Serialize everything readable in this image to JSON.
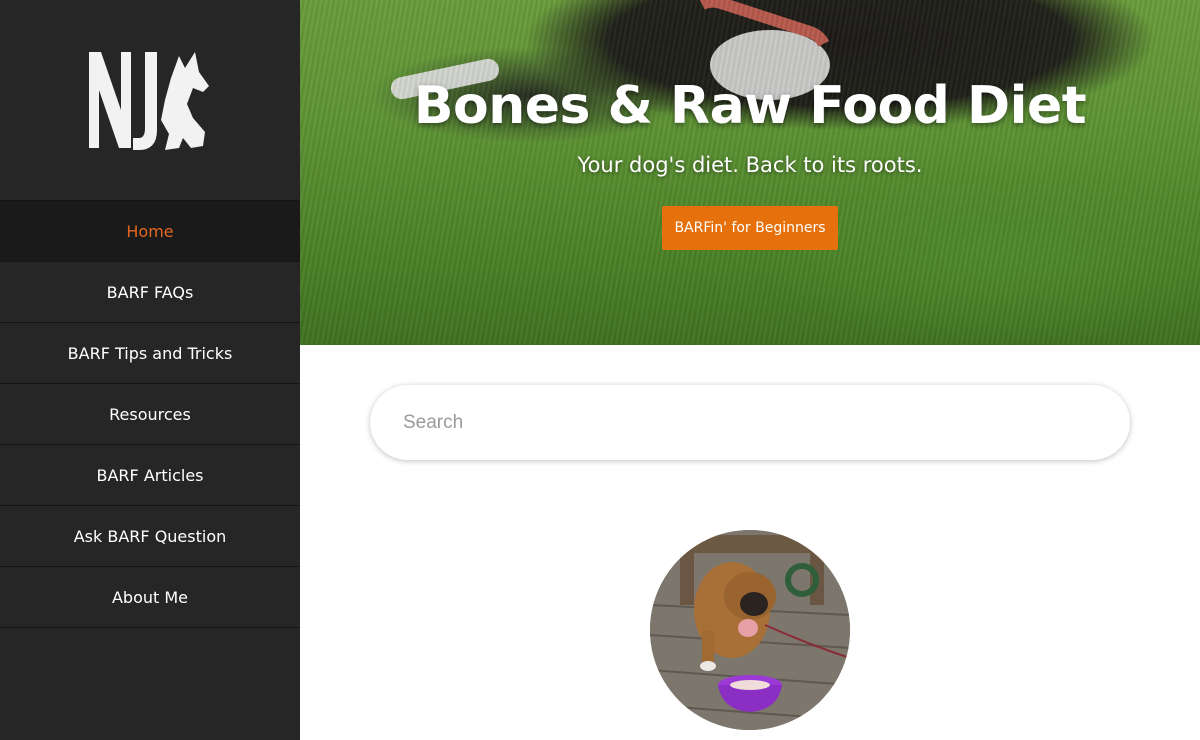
{
  "logo": {
    "text": "NJ"
  },
  "nav": {
    "items": [
      {
        "label": "Home",
        "active": true
      },
      {
        "label": "BARF FAQs",
        "active": false
      },
      {
        "label": "BARF Tips and Tricks",
        "active": false
      },
      {
        "label": "Resources",
        "active": false
      },
      {
        "label": "BARF Articles",
        "active": false
      },
      {
        "label": "Ask BARF Question",
        "active": false
      },
      {
        "label": "About Me",
        "active": false
      }
    ]
  },
  "hero": {
    "title": "Bones & Raw Food Diet",
    "subtitle": "Your dog's diet. Back to its roots.",
    "button_label": "BARFin' for Beginners"
  },
  "search": {
    "placeholder": "Search",
    "value": ""
  },
  "colors": {
    "sidebar_bg": "#262626",
    "accent": "#e5671f",
    "button": "#e5700c"
  }
}
